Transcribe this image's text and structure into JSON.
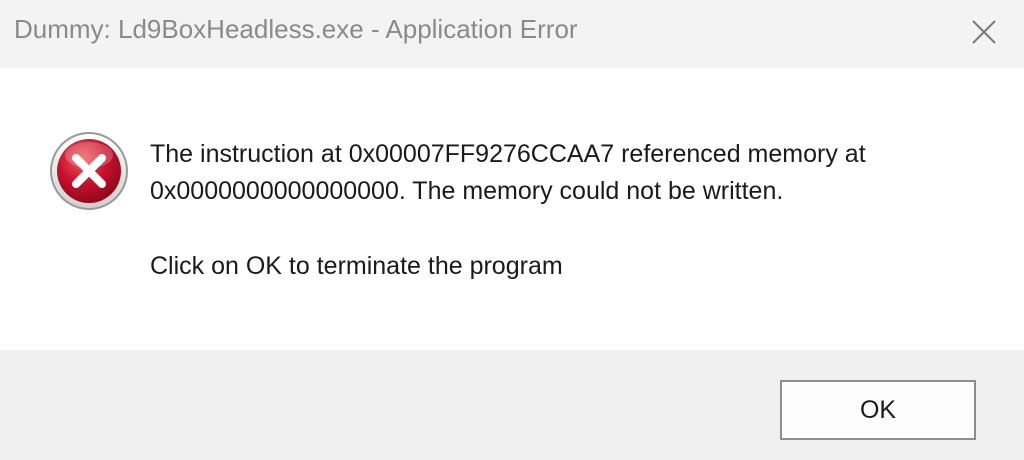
{
  "window": {
    "title": "Dummy: Ld9BoxHeadless.exe - Application Error",
    "close_icon": "close-icon"
  },
  "message": {
    "icon": "error-icon",
    "line1": "The instruction at 0x00007FF9276CCAA7 referenced memory at",
    "line2": "0x0000000000000000. The memory could not be written.",
    "instruction": "Click on OK to terminate the program"
  },
  "buttons": {
    "ok_label": "OK"
  },
  "colors": {
    "error_red": "#c8102e",
    "title_text": "#8a8a8a",
    "content_bg": "#ffffff",
    "footer_bg": "#f0f0f0"
  }
}
